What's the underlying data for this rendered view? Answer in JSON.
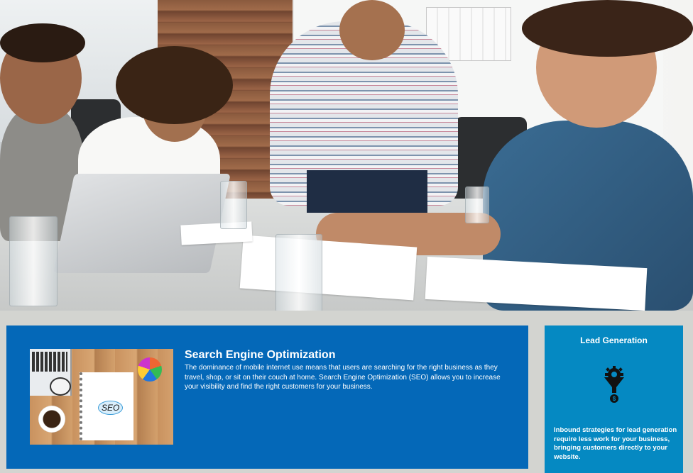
{
  "hero": {
    "image": "team-meeting-photo"
  },
  "seo": {
    "thumbnail_icon": "seo-notebook-photo",
    "thumbnail_word": "SEO",
    "title": "Search Engine Optimization",
    "text": "The dominance of mobile internet use means that users are searching for the right business as they travel, shop, or sit on their couch at home. Search Engine Optimization (SEO) allows you to increase your visibility and find the right customers for your business."
  },
  "lead": {
    "title": "Lead Generation",
    "icon": "gear-funnel-dollar-icon",
    "text": "Inbound strategies for lead generation require less work for your business, bringing customers directly to your website."
  },
  "colors": {
    "seo_card": "#0468b8",
    "lead_card": "#0589c2",
    "page_background": "#d3d4d0"
  }
}
